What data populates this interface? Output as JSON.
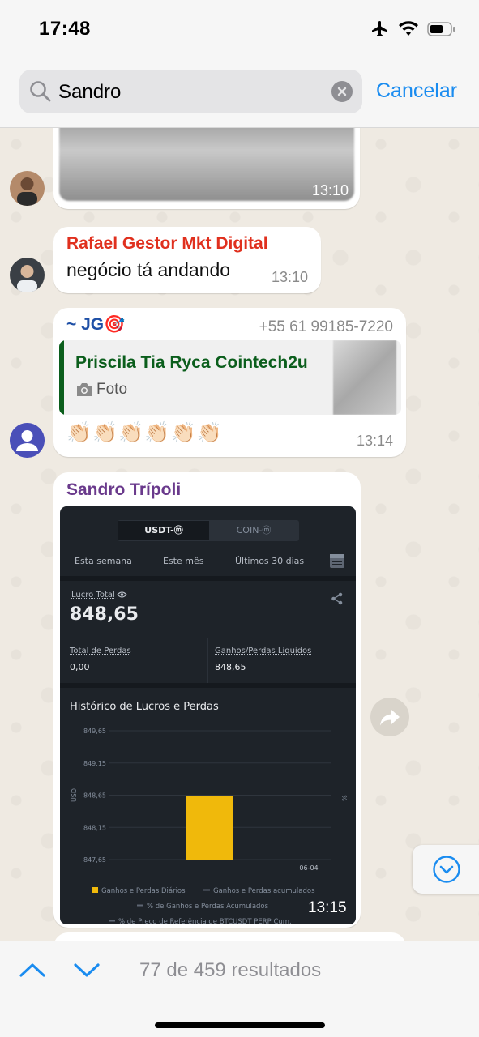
{
  "status_bar": {
    "time": "17:48"
  },
  "search": {
    "query": "Sandro",
    "cancel_label": "Cancelar"
  },
  "messages": {
    "m1": {
      "time": "13:10"
    },
    "m2": {
      "sender": "Rafael Gestor Mkt Digital",
      "sender_color": "#e0301e",
      "text": "negócio tá andando",
      "time": "13:10"
    },
    "m3": {
      "sender": "~ JG🎯",
      "sender_color": "#1e4fa6",
      "phone": "+55 61 99185-7220",
      "quote_name": "Priscila Tia Ryca Cointech2u",
      "quote_color": "#0b5e1c",
      "quote_type": "Foto",
      "text": "👏🏻👏🏻👏🏻👏🏻👏🏻👏🏻",
      "time": "13:14"
    },
    "m4": {
      "sender": "Sandro Trípoli",
      "sender_color": "#6a3a8c",
      "time": "13:15"
    }
  },
  "dashboard": {
    "tabs": [
      "USDT-ⓜ",
      "COIN-ⓜ"
    ],
    "periods": [
      "Esta semana",
      "Este mês",
      "Últimos 30 dias"
    ],
    "profit_label": "Lucro Total",
    "profit_value": "848,65",
    "losses_label": "Total de Perdas",
    "losses_value": "0,00",
    "net_label": "Ganhos/Perdas Líquidos",
    "net_value": "848,65",
    "chart_title": "Histórico de Lucros e Perdas"
  },
  "chart_data": {
    "type": "bar",
    "title": "Histórico de Lucros e Perdas",
    "xlabel": "",
    "ylabel": "USD",
    "y2label": "%",
    "categories": [
      "06-04"
    ],
    "values": [
      848.65
    ],
    "yticks": [
      "849,65",
      "849,15",
      "848,65",
      "848,15",
      "847,65"
    ],
    "ylim": [
      847.65,
      849.65
    ],
    "bar_color": "#f0b90b",
    "legend": [
      "Ganhos e Perdas Diários",
      "Ganhos e Perdas acumulados",
      "% de Ganhos e Perdas Acumulados",
      "% de Preço de Referência de BTCUSDT PERP Cum."
    ],
    "legend_position": "bottom"
  },
  "bottom_bar": {
    "results": "77 de 459 resultados"
  }
}
